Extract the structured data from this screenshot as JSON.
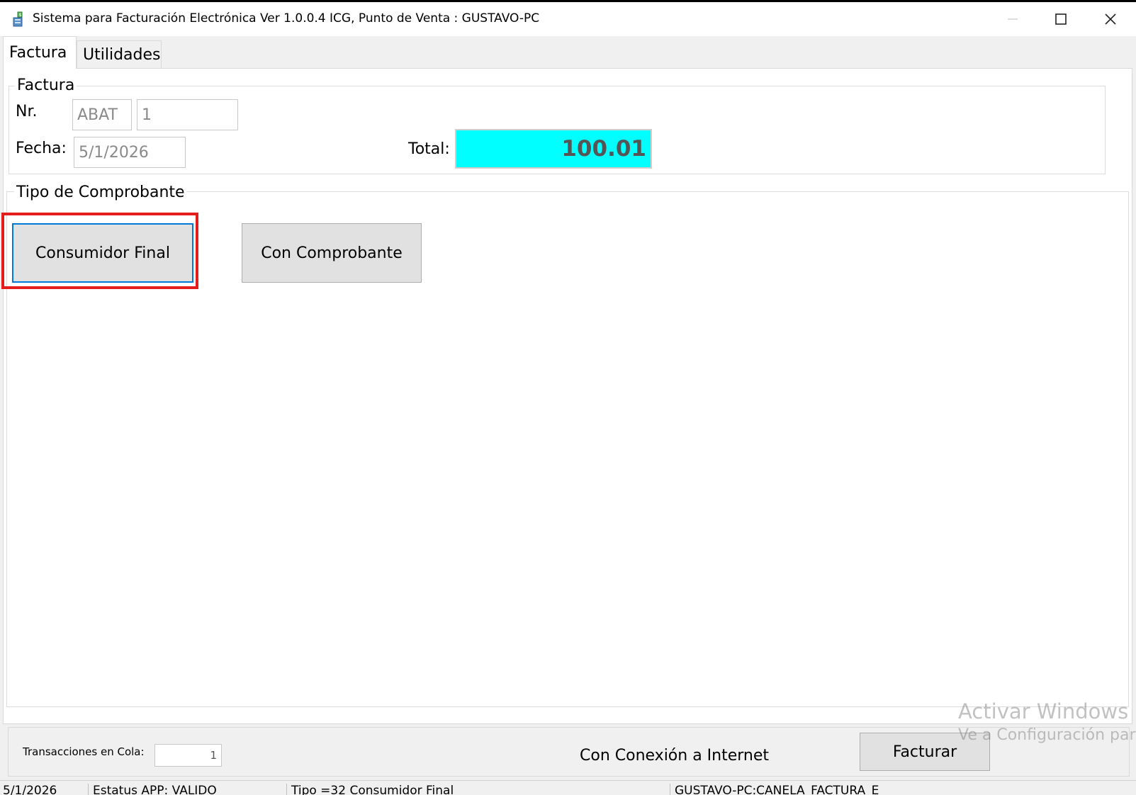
{
  "window": {
    "title": "Sistema para Facturación Electrónica  Ver 1.0.0.4 ICG, Punto de Venta : GUSTAVO-PC"
  },
  "tabs": [
    {
      "label": "Factura",
      "active": true
    },
    {
      "label": "Utilidades",
      "active": false
    }
  ],
  "factura": {
    "group_title": "Factura",
    "nr_label": "Nr.",
    "serie_value": "ABAT",
    "numero_value": "1",
    "fecha_label": "Fecha:",
    "fecha_value": "5/1/2026",
    "total_label": "Total:",
    "total_value": "100.01"
  },
  "tipo_comprobante": {
    "group_title": "Tipo de Comprobante",
    "consumidor_final_label": "Consumidor Final",
    "con_comprobante_label": "Con Comprobante"
  },
  "bottom": {
    "transacciones_label": "Transacciones en Cola:",
    "transacciones_value": "1",
    "conexion_text": "Con Conexión a Internet",
    "facturar_label": "Facturar"
  },
  "watermark": {
    "line1": "Activar Windows",
    "line2": "Ve a Configuración para"
  },
  "statusbar": {
    "fecha": "5/1/2026",
    "estatus": "Estatus APP: VALIDO",
    "tipo": "Tipo =32 Consumidor Final",
    "origen": "GUSTAVO-PC:CANELA_FACTURA_E"
  },
  "colors": {
    "total_background": "#00ffff",
    "highlight_border": "#e31c1c",
    "focus_border": "#0078d7"
  }
}
